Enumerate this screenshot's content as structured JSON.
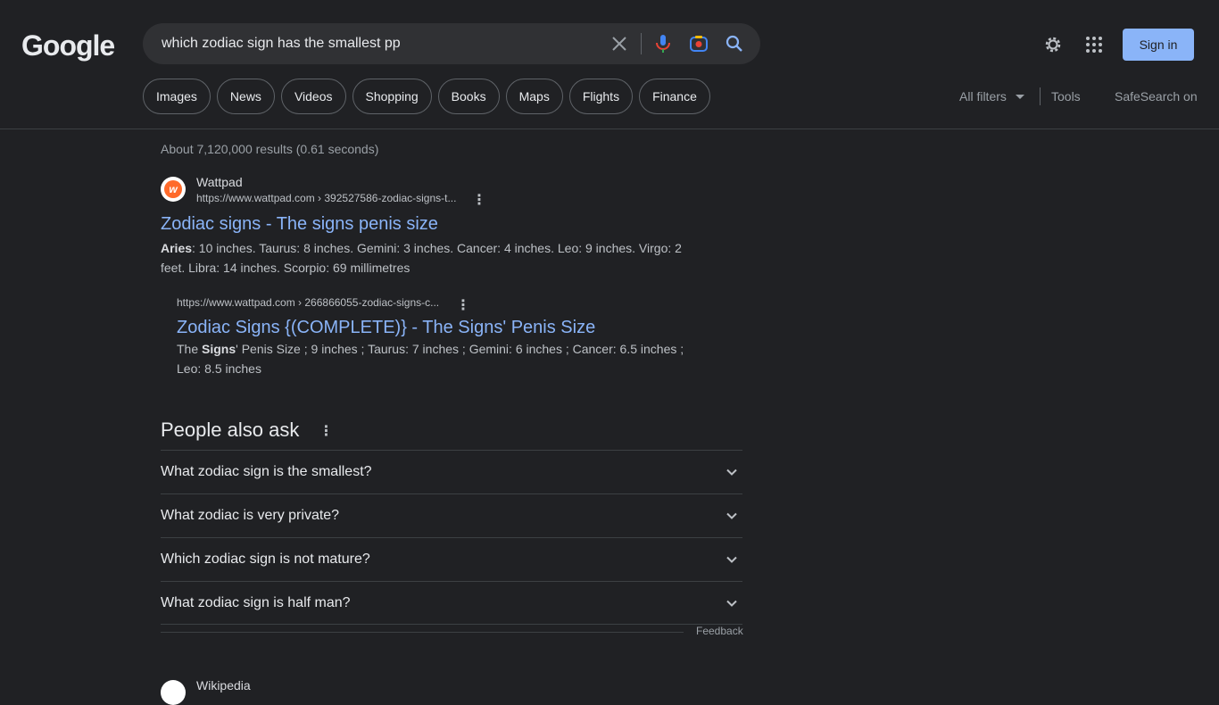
{
  "header": {
    "logo": "Google",
    "search_value": "which zodiac sign has the smallest pp",
    "signin_label": "Sign in"
  },
  "chips": [
    "Images",
    "News",
    "Videos",
    "Shopping",
    "Books",
    "Maps",
    "Flights",
    "Finance"
  ],
  "tools": {
    "all_filters": "All filters",
    "tools": "Tools",
    "safesearch": "SafeSearch on"
  },
  "stats": "About 7,120,000 results (0.61 seconds)",
  "result1": {
    "site": "Wattpad",
    "url": "https://www.wattpad.com › 392527586-zodiac-signs-t...",
    "title": "Zodiac signs - The signs penis size",
    "snippet_bold": "Aries",
    "snippet_rest": ": 10 inches. Taurus: 8 inches. Gemini: 3 inches. Cancer: 4 inches. Leo: 9 inches. Virgo: 2 feet. Libra: 14 inches. Scorpio: 69 millimetres"
  },
  "result2": {
    "url": "https://www.wattpad.com › 266866055-zodiac-signs-c...",
    "title": "Zodiac Signs {(COMPLETE)} - The Signs' Penis Size",
    "snippet_pre": "The ",
    "snippet_bold": "Signs",
    "snippet_rest": "' Penis Size ; 9 inches ; Taurus: 7 inches ; Gemini: 6 inches ; Cancer: 6.5 inches ; Leo: 8.5 inches"
  },
  "paa": {
    "heading": "People also ask",
    "questions": [
      "What zodiac sign is the smallest?",
      "What zodiac is very private?",
      "Which zodiac sign is not mature?",
      "What zodiac sign is half man?"
    ],
    "feedback": "Feedback"
  },
  "next_result": {
    "site": "Wikipedia"
  },
  "colors": {
    "background": "#202124",
    "link": "#8ab4f8",
    "accent_button": "#8ab4f8"
  }
}
